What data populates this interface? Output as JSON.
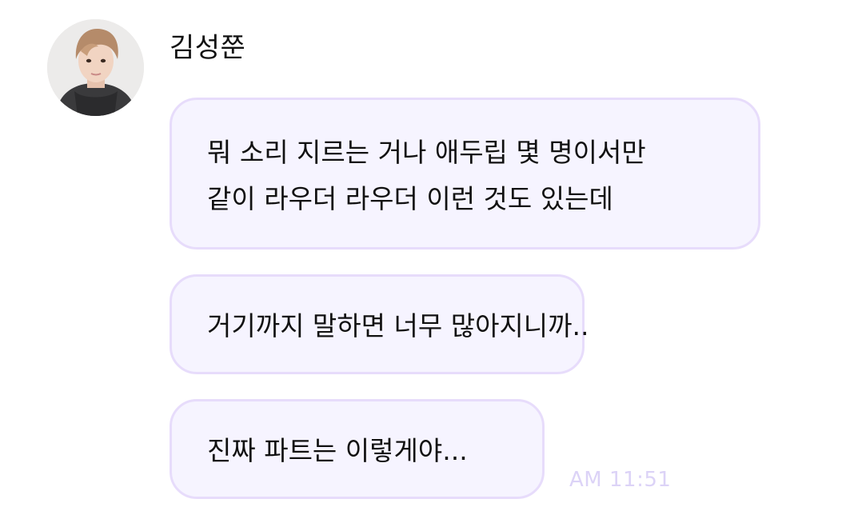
{
  "sender": {
    "name": "김성쭌"
  },
  "messages": [
    {
      "lines": [
        "뭐 소리 지르는 거나 애두립 몇 명이서만",
        "같이 라우더 라우더 이런 것도 있는데"
      ]
    },
    {
      "lines": [
        "거기까지 말하면 너무 많아지니까.."
      ]
    },
    {
      "lines": [
        "진짜 파트는 이렇게야..."
      ]
    }
  ],
  "timestamp": "AM 11:51",
  "colors": {
    "bubble_background": "#f6f4ff",
    "bubble_border": "#e7dcfb",
    "timestamp": "#dcd3f7",
    "text": "#111111"
  }
}
